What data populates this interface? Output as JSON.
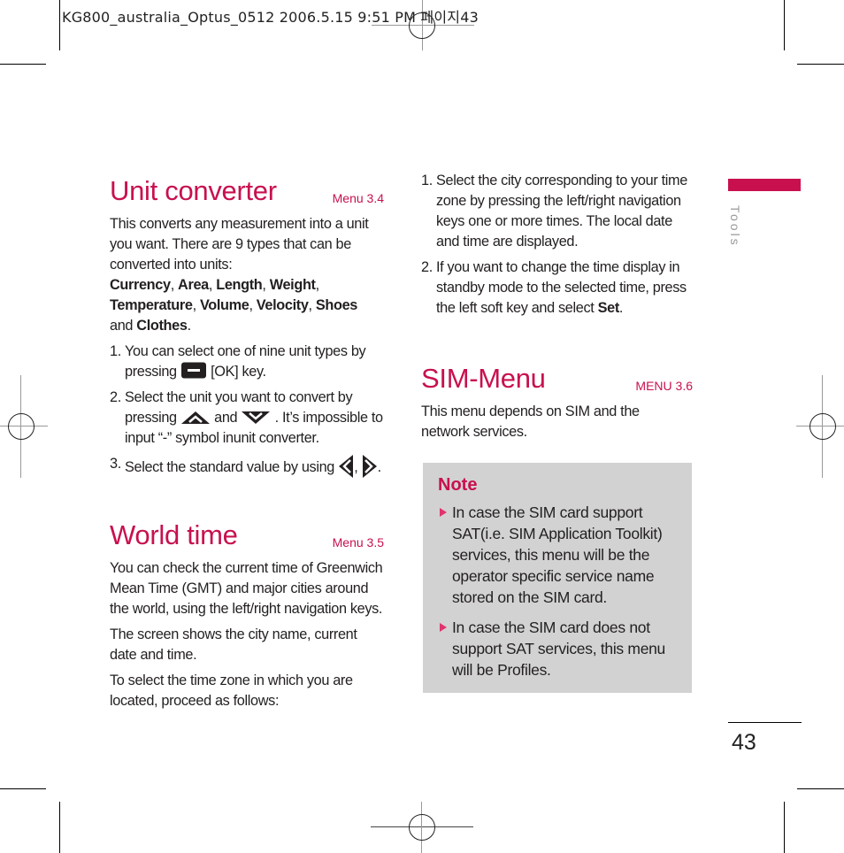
{
  "slug": {
    "text": "KG800_australia_Optus_0512  2006.5.15 9:51  PM  페이지43"
  },
  "sidebar": {
    "section_label": "Tools",
    "accent_color": "#c8104f"
  },
  "page_number": "43",
  "unit_converter": {
    "title": "Unit converter",
    "menu_ref": "Menu 3.4",
    "intro": "This converts any measurement into a unit you want. There are 9 types that can be converted into units:",
    "types": [
      "Currency",
      "Area",
      "Length",
      "Weight",
      "Temperature",
      "Volume",
      "Velocity",
      "Shoes",
      "Clothes"
    ],
    "sep_comma": ", ",
    "sep_and": " and ",
    "period": ".",
    "steps": [
      {
        "num": "1.",
        "pre": "You can select one of nine unit types by pressing",
        "key_icon": "ok-key-icon",
        "post": "[OK] key."
      },
      {
        "num": "2.",
        "pre": "Select the unit you want to convert by pressing",
        "key_icon_1": "up-key-icon",
        "mid": "and",
        "key_icon_2": "down-key-icon",
        "post": ". It’s impossible to input  “-” symbol inunit converter."
      },
      {
        "num": "3.",
        "pre": "Select the standard value by using",
        "key_icon_1": "left-key-icon",
        "mid": ",",
        "key_icon_2": "right-key-icon",
        "post": "."
      }
    ]
  },
  "world_time": {
    "title": "World time",
    "menu_ref": "Menu 3.5",
    "paragraphs": [
      "You can check the current time of Greenwich Mean Time (GMT) and major cities around the world, using the left/right navigation keys.",
      "The screen shows the city name, current date and time.",
      "To select the time zone in which you are located, proceed as follows:"
    ],
    "steps": [
      {
        "num": "1.",
        "text": "Select the city corresponding to your time zone by pressing the left/right navigation keys one or more times. The local date and time are displayed."
      },
      {
        "num": "2.",
        "text": "If you want to change the time display in standby mode to the selected time, press the left soft key and select ",
        "bold": "Set",
        "end": "."
      }
    ]
  },
  "sim_menu": {
    "title": "SIM-Menu",
    "menu_ref": "MENU 3.6",
    "intro": "This menu depends on SIM and the network services.",
    "note": {
      "title": "Note",
      "items": [
        "In case the SIM card support SAT(i.e. SIM Application Toolkit) services, this menu will be the operator specific service name stored on the SIM card.",
        "In case the SIM card does not support SAT services, this menu will be Profiles."
      ]
    }
  }
}
